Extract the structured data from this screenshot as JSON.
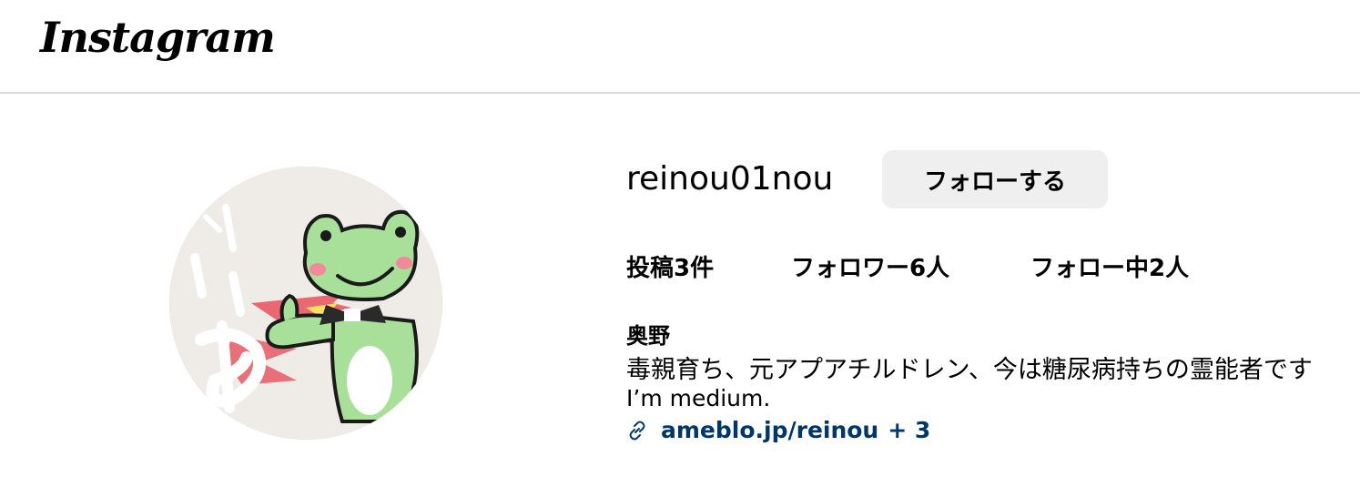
{
  "header": {
    "logo_text": "Instagram"
  },
  "profile": {
    "username": "reinou01nou",
    "follow_label": "フォローする",
    "stats": {
      "posts": "投稿3件",
      "followers": "フォロワー6人",
      "following": "フォロー中2人"
    },
    "full_name": "奥野",
    "bio_lines": [
      "毒親育ち、元アプアチルドレン、今は糖尿病持ちの霊能者です",
      "I’m medium."
    ],
    "link": {
      "text": "ameblo.jp/reinou",
      "more": "+ 3"
    },
    "avatar_icon": "frog-illustration"
  },
  "colors": {
    "link": "#00376b",
    "button_bg": "#efefef",
    "divider": "#dbdbdb"
  }
}
